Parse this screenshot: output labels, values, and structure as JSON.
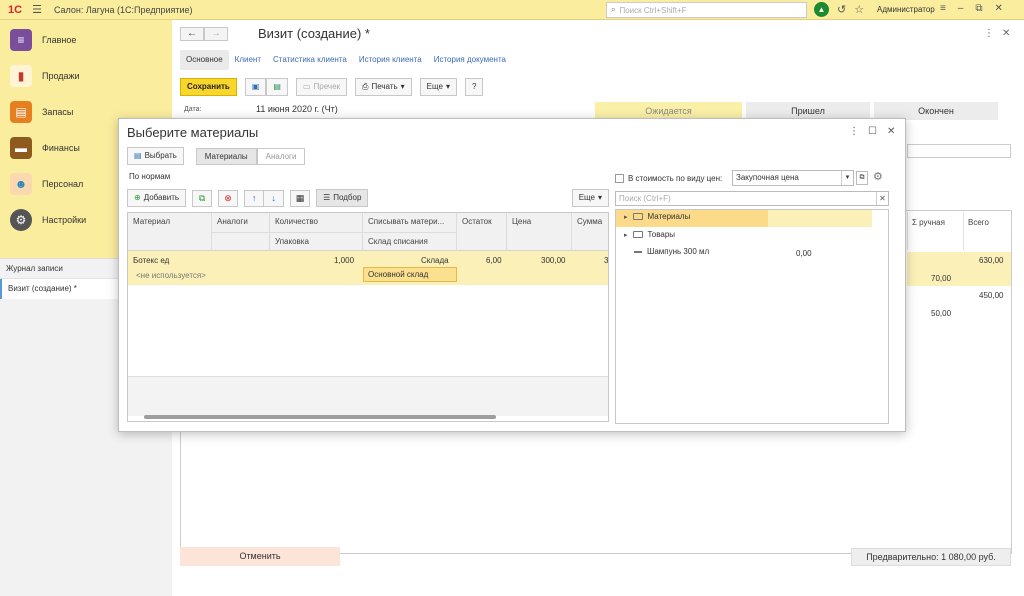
{
  "window": {
    "logo": "1С",
    "title": "Салон: Лагуна  (1С:Предприятие)",
    "search_placeholder": "Поиск Ctrl+Shift+F",
    "user": "Администратор"
  },
  "sidebar": {
    "items": [
      {
        "label": "Главное",
        "color": "#7a4e9c"
      },
      {
        "label": "Продажи",
        "color": "#c0392b"
      },
      {
        "label": "Запасы",
        "color": "#e67e22"
      },
      {
        "label": "Финансы",
        "color": "#8e5a1e"
      },
      {
        "label": "Персонал",
        "color": "#2e86c1"
      },
      {
        "label": "Настройки",
        "color": "#555555"
      }
    ],
    "journal": "Журнал записи",
    "current": "Визит (создание) *"
  },
  "main": {
    "title": "Визит (создание) *",
    "tabs": [
      "Основное",
      "Клиент",
      "Статистика клиента",
      "История клиента",
      "История документа"
    ],
    "save": "Сохранить",
    "recheck": "Пречек",
    "print": "Печать",
    "more": "Еще",
    "help": "?",
    "date_label": "Дата:",
    "date_value": "11 июня 2020 г. (Чт)",
    "statuses": [
      "Ожидается",
      "Пришел",
      "Окончен"
    ],
    "columns": [
      "Σ ручная",
      "Всего"
    ],
    "values": {
      "v1": "630,00",
      "v2": "70,00",
      "v3": "450,00",
      "v4": "50,00"
    },
    "cancel": "Отменить",
    "prelim": "Предварительно: 1 080,00 руб."
  },
  "dialog": {
    "title": "Выберите материалы",
    "choose": "Выбрать",
    "seg_materials": "Материалы",
    "seg_analogs": "Аналоги",
    "norms": "По нормам",
    "add": "Добавить",
    "pick": "Подбор",
    "more": "Еще",
    "grid": {
      "col_material": "Материал",
      "col_analogs": "Аналоги",
      "col_qty": "Количество",
      "col_pack": "Упаковка",
      "col_writeoff": "Списывать матери...",
      "col_warehouse": "Склад списания",
      "col_rest": "Остаток",
      "col_price": "Цена",
      "col_sum": "Сумма",
      "row_material": "Ботекс ед",
      "row_not_used": "<не используется>",
      "row_qty": "1,000",
      "row_writeoff": "Склада",
      "row_warehouse": "Основной склад",
      "row_rest": "6,00",
      "row_price": "300,00",
      "row_sum": "3"
    },
    "right": {
      "checkbox_label": "В стоимость по виду цен:",
      "price_type": "Закупочная цена",
      "search_placeholder": "Поиск (Ctrl+F)",
      "tree": [
        {
          "label": "Материалы",
          "kind": "folder",
          "value": ""
        },
        {
          "label": "Товары",
          "kind": "folder",
          "value": ""
        },
        {
          "label": "Шампунь 300 мл",
          "kind": "item",
          "value": "0,00"
        }
      ]
    }
  }
}
